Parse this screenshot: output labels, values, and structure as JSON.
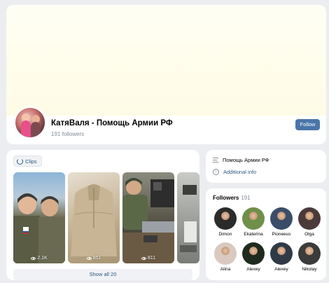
{
  "profile": {
    "name": "КатяВаля - Помощь Армии РФ",
    "followers": "191 followers",
    "follow_label": "Follow"
  },
  "clips": {
    "tab_label": "Clips",
    "items": [
      {
        "views": "2.1K"
      },
      {
        "views": "851"
      },
      {
        "views": "811"
      }
    ],
    "show_all_label": "Show all 20"
  },
  "info": {
    "description": "Помощь Армии РФ",
    "additional_info": "Additional info"
  },
  "followers": {
    "title": "Followers",
    "count": "191",
    "people": [
      {
        "name": "Dimon",
        "color": "#2b2b2b"
      },
      {
        "name": "Ekaterina",
        "color": "#6f8f4a"
      },
      {
        "name": "Pioneeus",
        "color": "#3a4d68"
      },
      {
        "name": "Olga",
        "color": "#4a3a3a"
      },
      {
        "name": "Alina",
        "color": "#d9c9c0"
      },
      {
        "name": "Alexey",
        "color": "#1f2a1f"
      },
      {
        "name": "Alexey",
        "color": "#2f3a46"
      },
      {
        "name": "Nikolay",
        "color": "#3b3b3b"
      }
    ]
  }
}
